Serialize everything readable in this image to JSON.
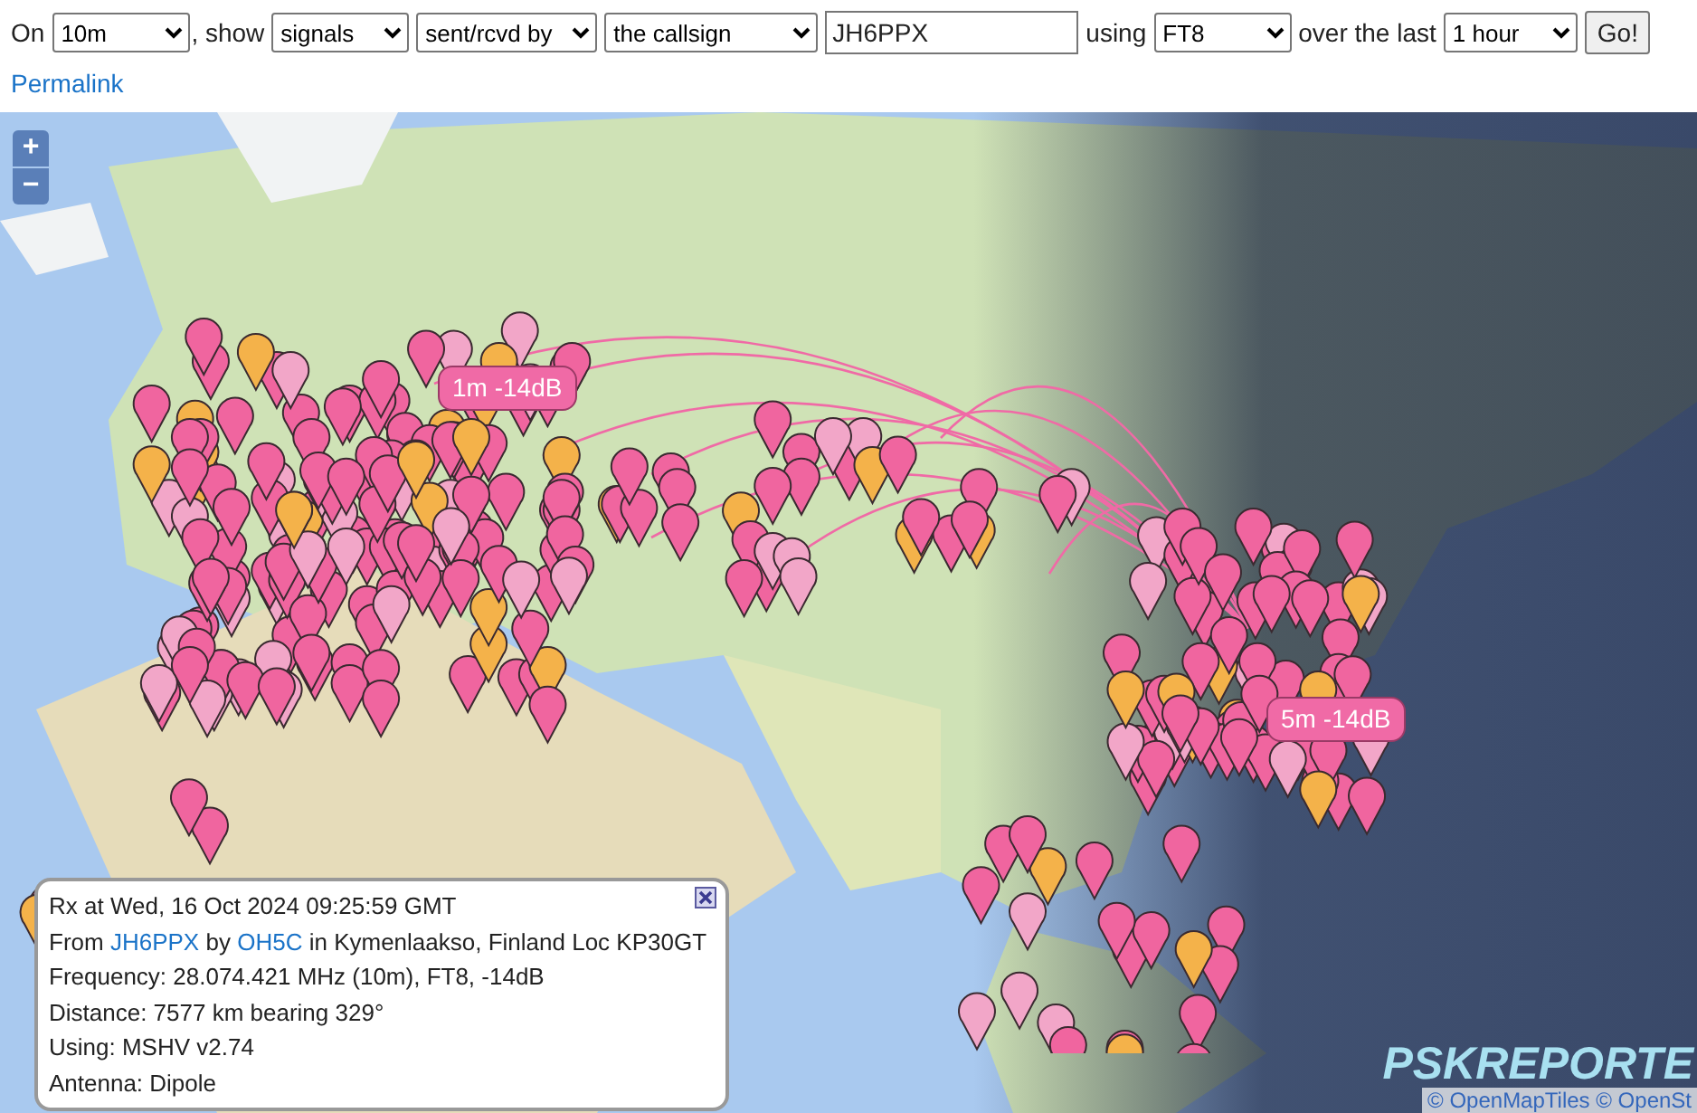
{
  "controls": {
    "prefix": "On",
    "band": "10m",
    "show_label": ", show",
    "show": "signals",
    "direction": "sent/rcvd by",
    "target": "the callsign",
    "callsign": "JH6PPX",
    "using_label": "using",
    "mode": "FT8",
    "over_label": "over the last",
    "period": "1 hour",
    "go": "Go!"
  },
  "permalink": "Permalink",
  "map": {
    "zoom_in": "+",
    "zoom_out": "−",
    "bubbles": [
      {
        "text": "1m -14dB"
      },
      {
        "text": "5m -14dB"
      }
    ],
    "popup": {
      "received": "Rx at Wed, 16 Oct 2024 09:25:59 GMT",
      "from": "From",
      "sender": "JH6PPX",
      "by": "by",
      "receiver": "OH5C",
      "location": "in Kymenlaakso, Finland Loc KP30GT",
      "frequency": "Frequency: 28.074.421 MHz (10m), FT8, -14dB",
      "distance": "Distance: 7577 km bearing 329°",
      "using": "Using: MSHV v2.74",
      "antenna": "Antenna: Dipole"
    },
    "logo": "PSKREPORTE",
    "attribution": "© OpenMapTiles © OpenSt"
  }
}
